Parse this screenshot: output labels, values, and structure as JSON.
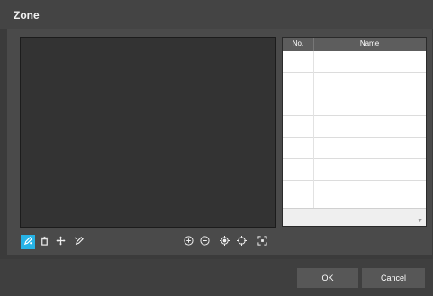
{
  "dialog": {
    "title": "Zone"
  },
  "zone_table": {
    "columns": [
      "No.",
      "Name"
    ],
    "rows": [
      {
        "no": "",
        "name": ""
      },
      {
        "no": "",
        "name": ""
      },
      {
        "no": "",
        "name": ""
      },
      {
        "no": "",
        "name": ""
      },
      {
        "no": "",
        "name": ""
      },
      {
        "no": "",
        "name": ""
      },
      {
        "no": "",
        "name": ""
      },
      {
        "no": "",
        "name": ""
      }
    ],
    "scroll_icon": "triangle-down-icon"
  },
  "left_toolbar": [
    {
      "name": "draw-zone",
      "icon": "pencil-icon",
      "active": true
    },
    {
      "name": "delete-zone",
      "icon": "trash-icon",
      "active": false
    },
    {
      "name": "move-zone",
      "icon": "move-icon",
      "active": false
    },
    {
      "name": "erase-zone",
      "icon": "eraser-icon",
      "active": false
    }
  ],
  "view_toolbar": [
    {
      "name": "zoom-in",
      "icon": "zoom-in-icon"
    },
    {
      "name": "zoom-out",
      "icon": "zoom-out-icon"
    },
    {
      "name": "center",
      "icon": "target-icon"
    },
    {
      "name": "locate",
      "icon": "crosshair-icon"
    },
    {
      "name": "fit",
      "icon": "fit-screen-icon"
    }
  ],
  "buttons": {
    "ok": "OK",
    "cancel": "Cancel"
  },
  "colors": {
    "accent": "#27b3e6",
    "background": "#3b3b3b",
    "viewport": "#333333"
  }
}
